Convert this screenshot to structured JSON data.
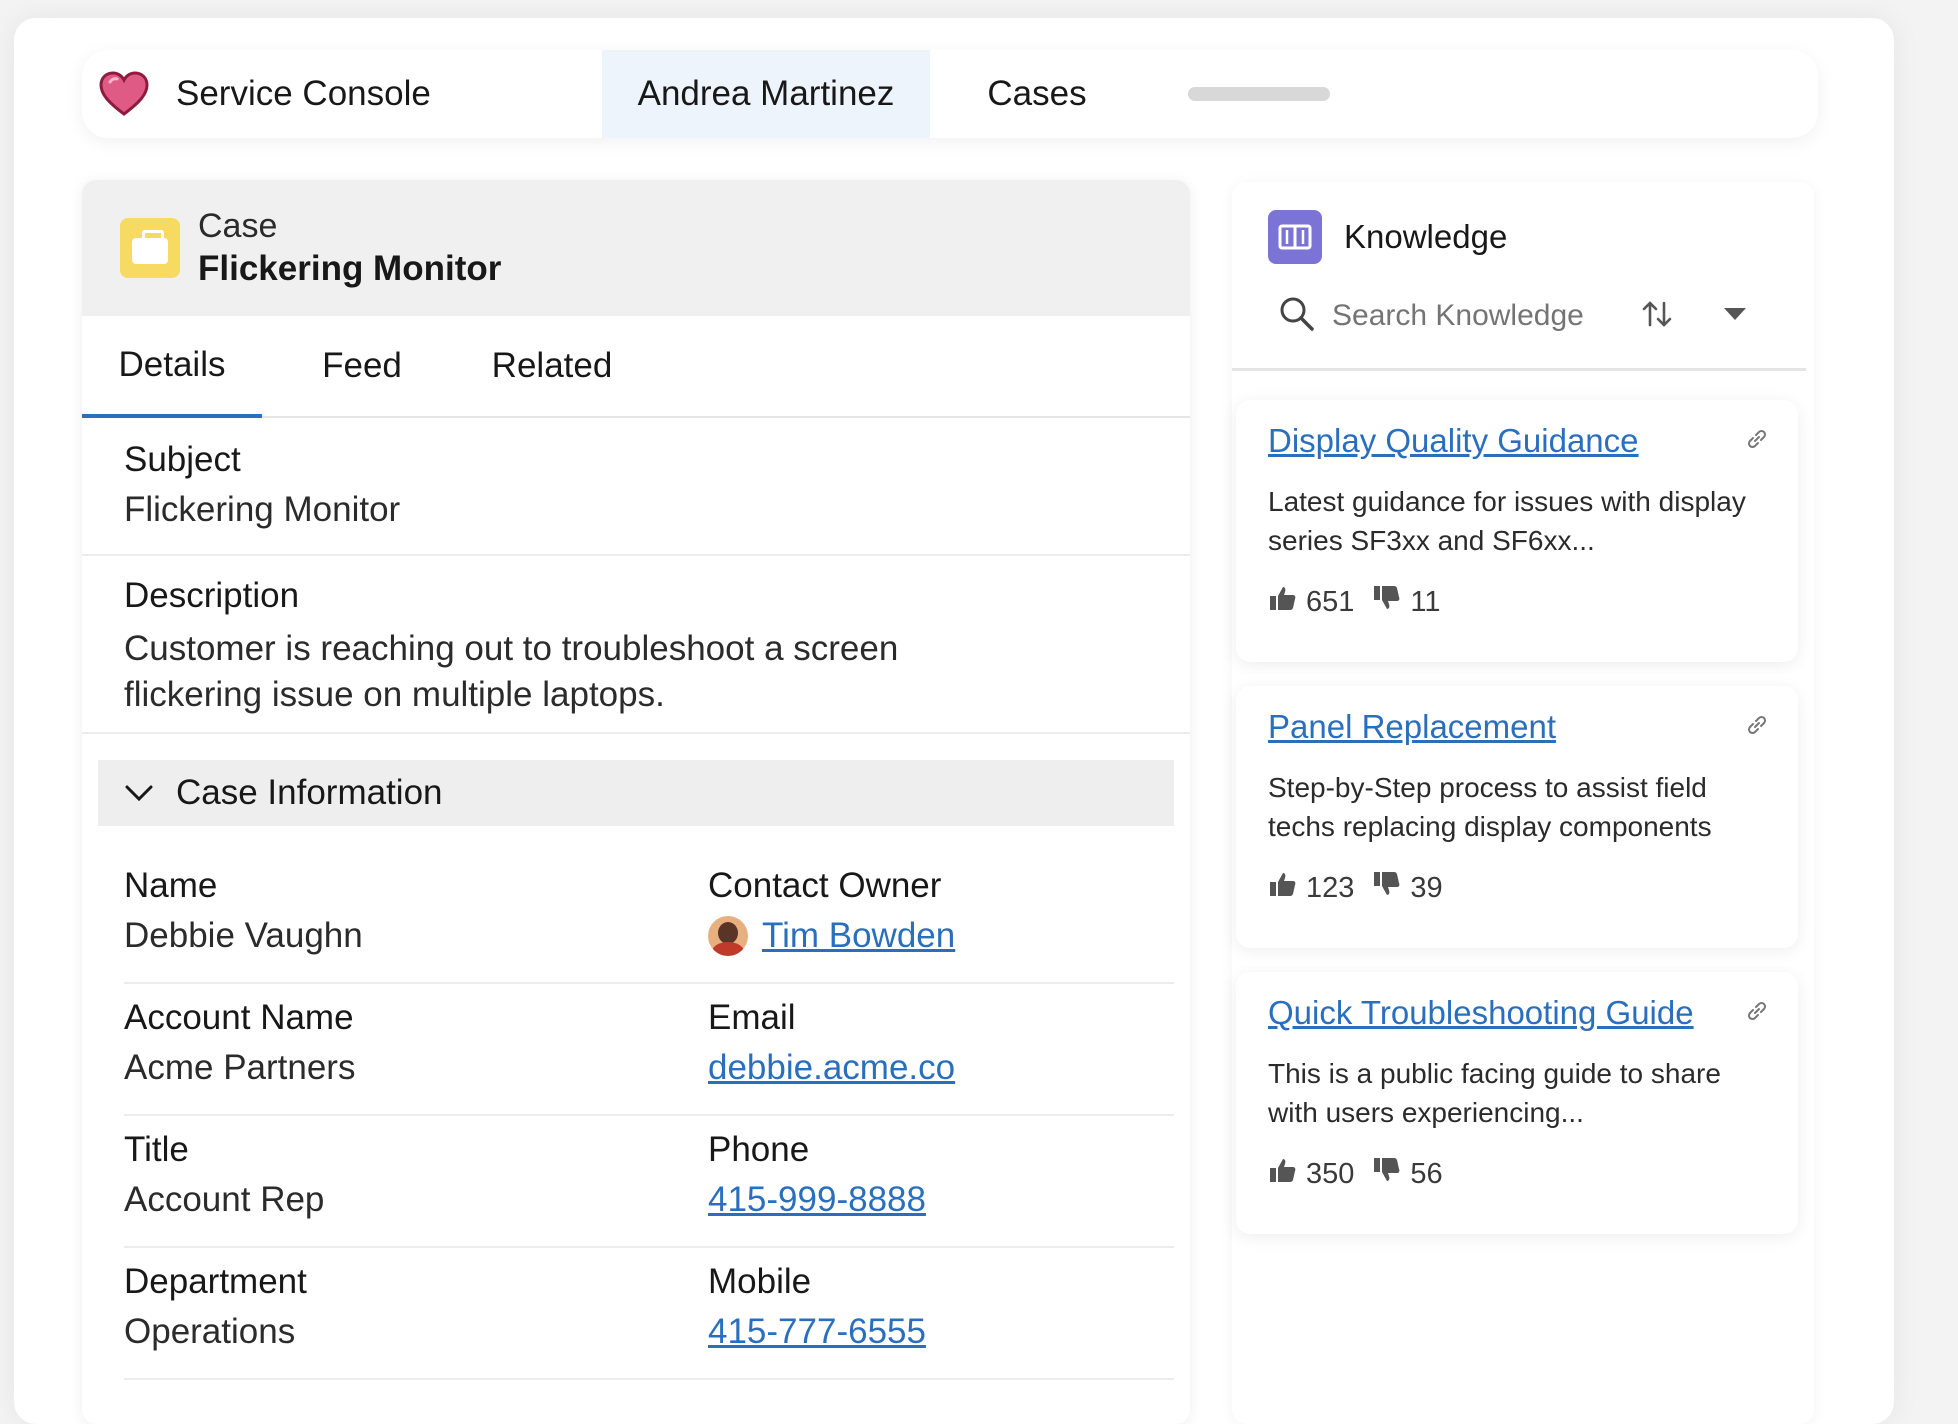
{
  "nav": {
    "app_name": "Service Console",
    "tabs": [
      {
        "label": "Andrea Martinez"
      },
      {
        "label": "Cases"
      }
    ]
  },
  "case": {
    "type_label": "Case",
    "title": "Flickering Monitor",
    "tabs": [
      "Details",
      "Feed",
      "Related"
    ],
    "subject": {
      "label": "Subject",
      "value": "Flickering Monitor"
    },
    "description": {
      "label": "Description",
      "value": "Customer is reaching out to troubleshoot a screen flickering issue on multiple laptops."
    },
    "section_title": "Case Information",
    "fields": [
      {
        "left_label": "Name",
        "left_value": "Debbie Vaughn",
        "right_label": "Contact Owner",
        "right_value": "Tim Bowden"
      },
      {
        "left_label": "Account Name",
        "left_value": "Acme Partners",
        "right_label": "Email",
        "right_value": "debbie.acme.co"
      },
      {
        "left_label": "Title",
        "left_value": "Account Rep",
        "right_label": "Phone",
        "right_value": "415-999-8888"
      },
      {
        "left_label": "Department",
        "left_value": "Operations",
        "right_label": "Mobile",
        "right_value": "415-777-6555"
      }
    ]
  },
  "knowledge": {
    "title": "Knowledge",
    "search_placeholder": "Search Knowledge",
    "articles": [
      {
        "title": "Display Quality Guidance",
        "desc": "Latest guidance for issues with display series SF3xx and SF6xx...",
        "up": "651",
        "down": "11"
      },
      {
        "title": "Panel Replacement",
        "desc": "Step-by-Step process to assist field techs replacing display components",
        "up": "123",
        "down": "39"
      },
      {
        "title": "Quick Troubleshooting Guide",
        "desc": "This is a public facing guide to share with users experiencing...",
        "up": "350",
        "down": "56"
      }
    ]
  },
  "colors": {
    "accent": "#2a6fbe",
    "case_icon": "#f6da62",
    "knowledge_icon": "#7b73d6",
    "heart": "#c2185b"
  },
  "icons": {
    "brand": "heart-icon",
    "case": "briefcase-icon",
    "knowledge": "book-icon",
    "search": "search-icon",
    "sort": "sort-icon",
    "dropdown": "caret-down-icon",
    "link": "link-icon",
    "thumbs_up": "thumbs-up-icon",
    "thumbs_down": "thumbs-down-icon",
    "chevron": "chevron-down-icon"
  }
}
